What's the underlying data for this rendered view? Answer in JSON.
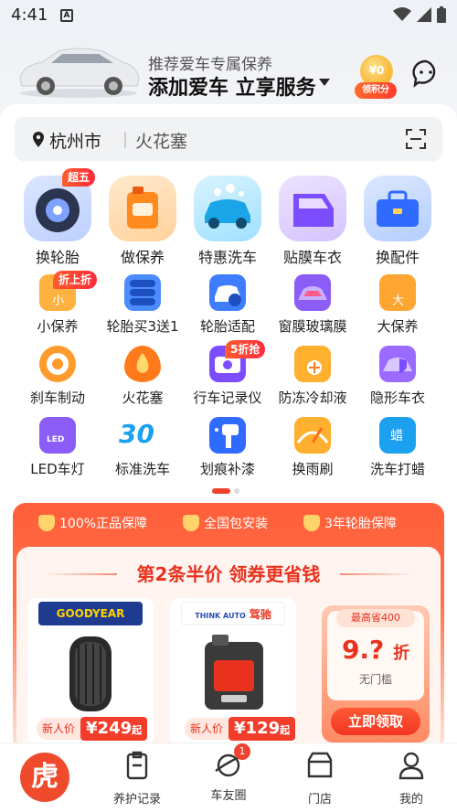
{
  "status_bar": {
    "time": "4:41",
    "notification_icon": "A"
  },
  "header": {
    "subtitle": "推荐爱车专属保养",
    "title": "添加爱车 立享服务",
    "points_coin": "¥0",
    "points_label": "领积分"
  },
  "search": {
    "city": "杭州市",
    "keyword": "火花塞"
  },
  "primary_services": [
    {
      "label": "换轮胎",
      "badge": "超五"
    },
    {
      "label": "做保养",
      "badge": ""
    },
    {
      "label": "特惠洗车",
      "badge": ""
    },
    {
      "label": "贴膜车衣",
      "badge": ""
    },
    {
      "label": "换配件",
      "badge": ""
    }
  ],
  "secondary_services": [
    {
      "label": "小保养",
      "badge": "折上折"
    },
    {
      "label": "轮胎买3送1",
      "badge": ""
    },
    {
      "label": "轮胎适配",
      "badge": ""
    },
    {
      "label": "窗膜玻璃膜",
      "badge": ""
    },
    {
      "label": "大保养",
      "badge": ""
    },
    {
      "label": "刹车制动",
      "badge": ""
    },
    {
      "label": "火花塞",
      "badge": ""
    },
    {
      "label": "行车记录仪",
      "badge": "5折抢"
    },
    {
      "label": "防冻冷却液",
      "badge": ""
    },
    {
      "label": "隐形车衣",
      "badge": ""
    },
    {
      "label": "LED车灯",
      "badge": ""
    },
    {
      "label": "标准洗车",
      "badge": ""
    },
    {
      "label": "划痕补漆",
      "badge": ""
    },
    {
      "label": "换雨刷",
      "badge": ""
    },
    {
      "label": "洗车打蜡",
      "badge": ""
    }
  ],
  "icon_text": {
    "xiao": "小",
    "da": "大",
    "led": "LED",
    "wash30": "30",
    "la": "蜡"
  },
  "guarantees": [
    "100%正品保障",
    "全国包安装",
    "3年轮胎保障"
  ],
  "promo": {
    "title": "第2条半价  领券更省钱",
    "products": [
      {
        "brand": "GOODYEAR",
        "tag": "新人价",
        "price": "¥249",
        "unit": "起"
      },
      {
        "brand": "驾驰",
        "brand_prefix": "THINK AUTO",
        "tag": "新人价",
        "price": "¥129",
        "unit": "起"
      }
    ],
    "coupon": {
      "top": "最高省400",
      "amount": "9.?",
      "amount_unit": "折",
      "sub": "无门槛",
      "button": "立即领取"
    }
  },
  "nav": [
    {
      "label": ""
    },
    {
      "label": "养护记录"
    },
    {
      "label": "车友圈",
      "badge": "1"
    },
    {
      "label": "门店"
    },
    {
      "label": "我的"
    }
  ],
  "nav_home_glyph": "虎",
  "colors": {
    "accent": "#f0412f",
    "promo_red": "#ff5e3a",
    "brand_text": "#e8321e"
  }
}
